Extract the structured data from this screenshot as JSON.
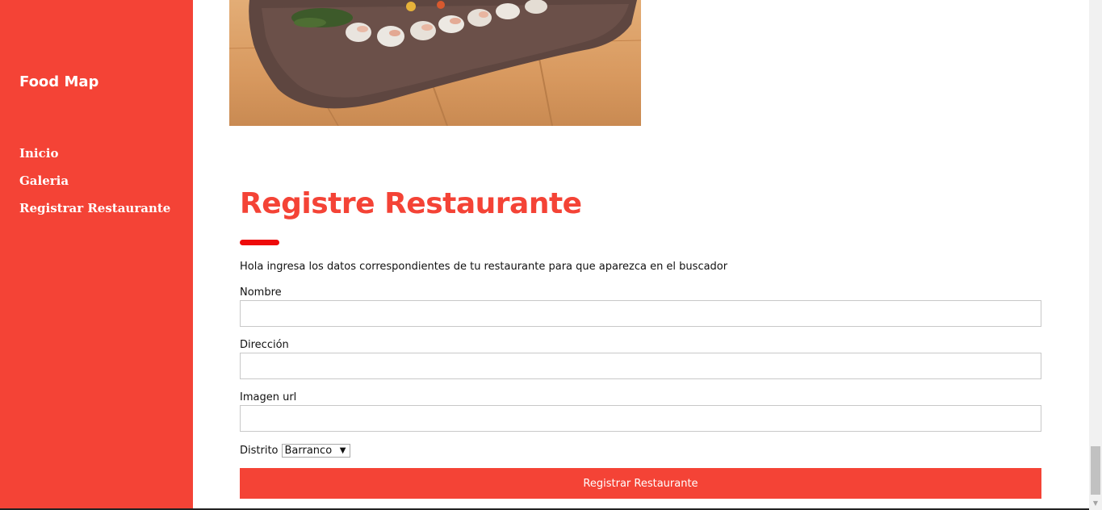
{
  "sidebar": {
    "brand": "Food Map",
    "items": [
      {
        "label": "Inicio"
      },
      {
        "label": "Galeria"
      },
      {
        "label": "Registrar Restaurante"
      }
    ]
  },
  "form": {
    "title": "Registre Restaurante",
    "intro": "Hola ingresa los datos correspondientes de tu restaurante para que aparezca en el buscador",
    "fields": {
      "nombre": {
        "label": "Nombre",
        "value": ""
      },
      "direccion": {
        "label": "Dirección",
        "value": ""
      },
      "imagen": {
        "label": "Imagen url",
        "value": ""
      }
    },
    "distrito": {
      "label": "Distrito",
      "selected": "Barranco"
    },
    "submit_label": "Registrar Restaurante"
  },
  "colors": {
    "accent": "#f44336",
    "underline": "#ee0a0a"
  }
}
